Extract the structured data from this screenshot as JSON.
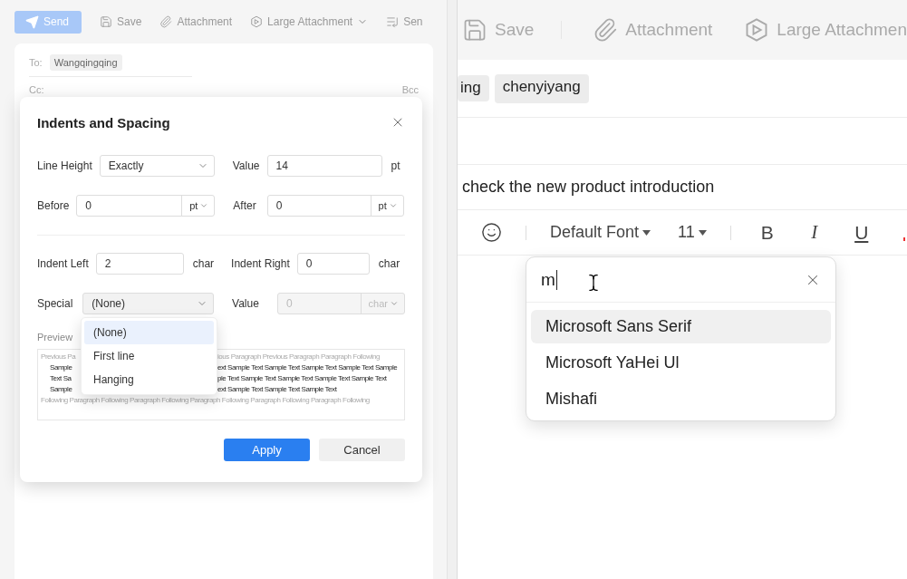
{
  "left": {
    "toolbar": [
      {
        "kind": "send",
        "label": "Send",
        "primary": true
      },
      {
        "kind": "save",
        "label": "Save",
        "primary": false
      },
      {
        "kind": "attach",
        "label": "Attachment",
        "primary": false
      },
      {
        "kind": "large",
        "label": "Large Attachment",
        "primary": false,
        "dropdown": true
      },
      {
        "kind": "schedule",
        "label": "Sen",
        "primary": false
      }
    ],
    "to": {
      "label": "To:",
      "chips": [
        "Wangqingqing"
      ]
    },
    "cc": {
      "label": "Cc:",
      "bcc": "Bcc"
    },
    "dialog": {
      "title": "Indents and Spacing",
      "line_height": {
        "label": "Line Height",
        "mode": "Exactly",
        "value_label": "Value",
        "value": "14",
        "unit": "pt"
      },
      "before": {
        "label": "Before",
        "value": "0",
        "unit": "pt"
      },
      "after": {
        "label": "After",
        "value": "0",
        "unit": "pt"
      },
      "indent_left": {
        "label": "Indent Left",
        "value": "2",
        "unit": "char"
      },
      "indent_right": {
        "label": "Indent Right",
        "value": "0",
        "unit": "char"
      },
      "special": {
        "label": "Special",
        "value": "(None)",
        "value_label": "Value",
        "amount": "0",
        "unit": "char",
        "amount_disabled": true,
        "options": [
          {
            "label": "(None)",
            "selected": true
          },
          {
            "label": "First line",
            "selected": false
          },
          {
            "label": "Hanging",
            "selected": false
          }
        ]
      },
      "preview_label": "Preview",
      "preview_lines": [
        {
          "kind": "context",
          "left": "Previous Pa",
          "right": "ious Paragraph Previous Paragraph Paragraph Following"
        },
        {
          "kind": "sample",
          "left": "Sample",
          "right": "ext Sample Text Sample Text Sample Text Sample Text Sample"
        },
        {
          "kind": "sample2",
          "left": "Text Sa",
          "right": "ple Text Sample Text Sample Text Sample Text Sample Text"
        },
        {
          "kind": "sample",
          "left": "Sample",
          "right": "ext Sample Text Sample Text Sample Text"
        },
        {
          "kind": "context",
          "left": "Following Paragraph Following Paragraph Following Paragraph Following Paragraph Following Paragraph Following"
        }
      ],
      "apply": "Apply",
      "cancel": "Cancel"
    }
  },
  "right": {
    "toolbar": [
      {
        "kind": "save",
        "label": "Save"
      },
      {
        "kind": "attach",
        "label": "Attachment"
      },
      {
        "kind": "large",
        "label": "Large Attachmen"
      }
    ],
    "chips": [
      "ing",
      "chenyiyang"
    ],
    "subject": "check the new product introduction",
    "format": {
      "font": "Default Font",
      "size": "11",
      "bold": "B",
      "italic": "I",
      "underline": "U"
    },
    "font_search": {
      "value": "m",
      "options": [
        {
          "label": "Microsoft Sans Serif",
          "selected": true
        },
        {
          "label": "Microsoft YaHei Ul",
          "selected": false
        },
        {
          "label": "Mishafi",
          "selected": false
        }
      ]
    }
  }
}
